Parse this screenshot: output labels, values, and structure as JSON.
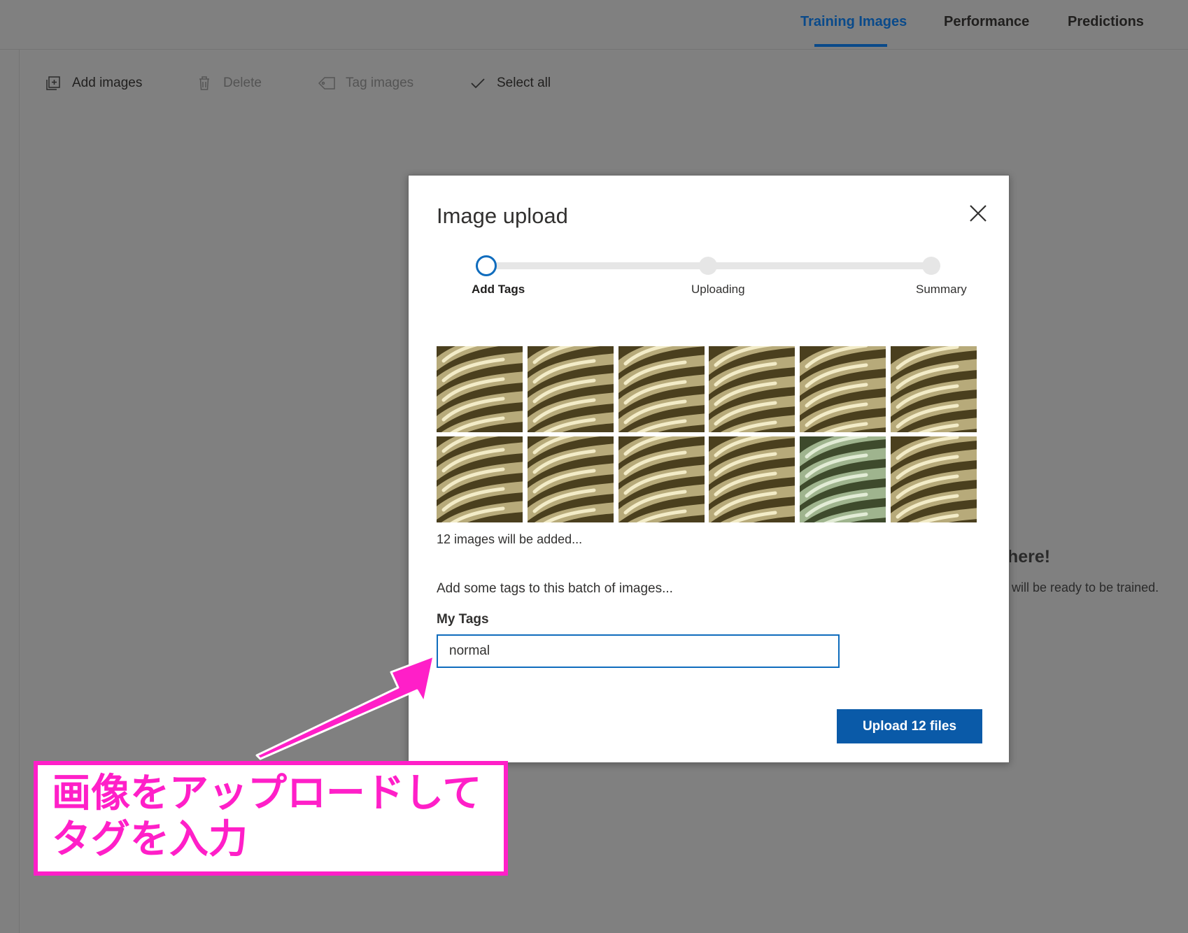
{
  "header": {
    "tabs": [
      {
        "label": "Training Images",
        "active": true
      },
      {
        "label": "Performance",
        "active": false
      },
      {
        "label": "Predictions",
        "active": false
      }
    ]
  },
  "toolbar": {
    "add_images": "Add images",
    "delete": "Delete",
    "tag_images": "Tag images",
    "select_all": "Select all"
  },
  "background": {
    "partial_heading": "here!",
    "partial_text": "will be ready to be trained."
  },
  "dialog": {
    "title": "Image upload",
    "steps": [
      {
        "label": "Add Tags",
        "state": "current"
      },
      {
        "label": "Uploading",
        "state": "pending"
      },
      {
        "label": "Summary",
        "state": "pending"
      }
    ],
    "thumbnail_count": 12,
    "count_text": "12 images will be added...",
    "tags_prompt": "Add some tags to this batch of images...",
    "tags_label": "My Tags",
    "tags_value": "normal",
    "upload_button": "Upload 12 files"
  },
  "annotation": {
    "line1": "画像をアップロードして",
    "line2": "タグを入力",
    "color": "#ff1fc8"
  },
  "colors": {
    "accent": "#0f6cbd",
    "overlay": "#808080"
  }
}
